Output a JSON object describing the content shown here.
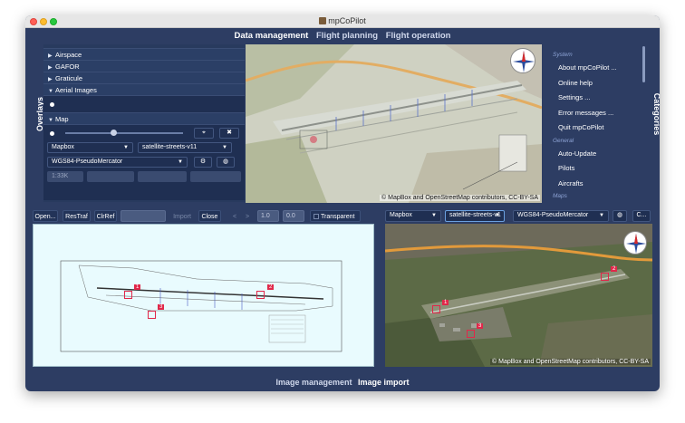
{
  "window": {
    "title": "mpCoPilot"
  },
  "top_tabs": [
    "Data management",
    "Flight planning",
    "Flight operation"
  ],
  "top_tab_active": "Data management",
  "overlays_label": "Overlays",
  "categories_label": "Categories",
  "overlay_tree": [
    {
      "label": "Airspace",
      "expanded": false
    },
    {
      "label": "GAFOR",
      "expanded": false
    },
    {
      "label": "Graticule",
      "expanded": false
    },
    {
      "label": "Aerial Images",
      "expanded": true
    },
    {
      "label": "Map",
      "expanded": true
    }
  ],
  "map_controls": {
    "provider": "Mapbox",
    "style": "satellite-streets-v11",
    "projection": "WGS84-PseudoMercator",
    "scale_field": "1:33K",
    "opacity_fraction": 0.4
  },
  "map_attribution": "© MapBox and OpenStreetMap contributors, CC-BY-SA",
  "categories": [
    {
      "section": "System",
      "items": [
        "About mpCoPilot ...",
        "Online help",
        "Settings ...",
        "Error messages ...",
        "Quit mpCoPilot"
      ]
    },
    {
      "section": "General",
      "items": [
        "Auto-Update",
        "Pilots",
        "Aircrafts"
      ]
    },
    {
      "section": "Maps",
      "items": []
    }
  ],
  "import_toolbar": {
    "open": "Open...",
    "restraf": "ResTraf",
    "clrref": "ClrRef",
    "import": "Import",
    "close": "Close",
    "prev": "<",
    "next": ">",
    "val1": "1.0",
    "val2": "0.0",
    "transparency": "Transparent"
  },
  "bottom_map_controls": {
    "provider": "Mapbox",
    "style": "satellite-streets-v1",
    "projection": "WGS84-PseudoMercator",
    "more": "C..."
  },
  "bottom_attribution": "© MapBox and OpenStreetMap contributors, CC-BY-SA",
  "ref_points": [
    "1",
    "2",
    "3"
  ],
  "bottom_tabs": [
    "Image management",
    "Image import"
  ],
  "bottom_tab_active": "Image import",
  "colors": {
    "window_bg": "#2d3d63",
    "marker": "#e0284a"
  }
}
